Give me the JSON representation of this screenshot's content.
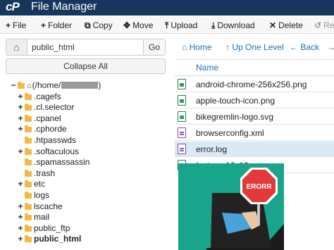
{
  "header": {
    "logo": "cP",
    "title": "File Manager"
  },
  "toolbar": {
    "file": "File",
    "folder": "Folder",
    "copy": "Copy",
    "move": "Move",
    "upload": "Upload",
    "download": "Download",
    "delete": "Delete",
    "restore": "Re"
  },
  "path": {
    "value": "public_html",
    "go": "Go"
  },
  "collapse_all": "Collapse All",
  "tree": [
    {
      "toggle": "−",
      "label": "(/home/",
      "home": true
    },
    {
      "toggle": "+",
      "label": ".cagefs"
    },
    {
      "toggle": "+",
      "label": ".cl.selector"
    },
    {
      "toggle": "+",
      "label": ".cpanel"
    },
    {
      "toggle": "+",
      "label": ".cphorde"
    },
    {
      "toggle": "",
      "label": ".htpasswds"
    },
    {
      "toggle": "+",
      "label": ".softaculous"
    },
    {
      "toggle": "",
      "label": ".spamassassin"
    },
    {
      "toggle": "",
      "label": ".trash"
    },
    {
      "toggle": "+",
      "label": "etc"
    },
    {
      "toggle": "",
      "label": "logs"
    },
    {
      "toggle": "+",
      "label": "lscache"
    },
    {
      "toggle": "+",
      "label": "mail"
    },
    {
      "toggle": "+",
      "label": "public_ftp"
    },
    {
      "toggle": "+",
      "label": "public_html"
    }
  ],
  "nav": {
    "home": "Home",
    "up": "Up One Level",
    "back": "Back"
  },
  "list": {
    "name_header": "Name",
    "files": [
      {
        "name": "android-chrome-256x256.png",
        "type": "img"
      },
      {
        "name": "apple-touch-icon.png",
        "type": "img"
      },
      {
        "name": "bikegremlin-logo.svg",
        "type": "img"
      },
      {
        "name": "browserconfig.xml",
        "type": "xml"
      },
      {
        "name": "error.log",
        "type": "xml"
      },
      {
        "name": "favicon-16x16.png",
        "type": "img"
      }
    ]
  },
  "illustration": {
    "sign_text": "ERORR"
  },
  "colors": {
    "header_bg": "#17365d",
    "link": "#1f6fb5",
    "folder": "#f4b942",
    "selected_row": "#dbe8f6",
    "illustration_bg": "#19a58c",
    "sign_red": "#e23a3a"
  }
}
